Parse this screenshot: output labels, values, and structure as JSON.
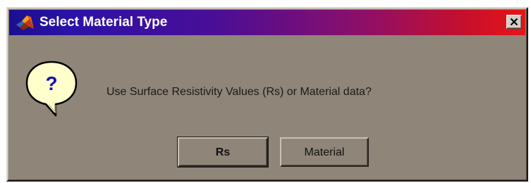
{
  "window": {
    "title": "Select Material Type",
    "title_icon": "matlab-logo-icon",
    "close_icon": "close-icon"
  },
  "dialog": {
    "icon": "question-icon",
    "icon_glyph": "?",
    "message": "Use Surface Resistivity Values (Rs) or Material data?"
  },
  "buttons": {
    "rs_label": "Rs",
    "material_label": "Material"
  },
  "colors": {
    "titlebar_start": "#1a0f8e",
    "titlebar_end": "#e81414",
    "dialog_background": "#8f8578",
    "question_bubble": "#ffffcc",
    "question_mark": "#1010c0"
  }
}
